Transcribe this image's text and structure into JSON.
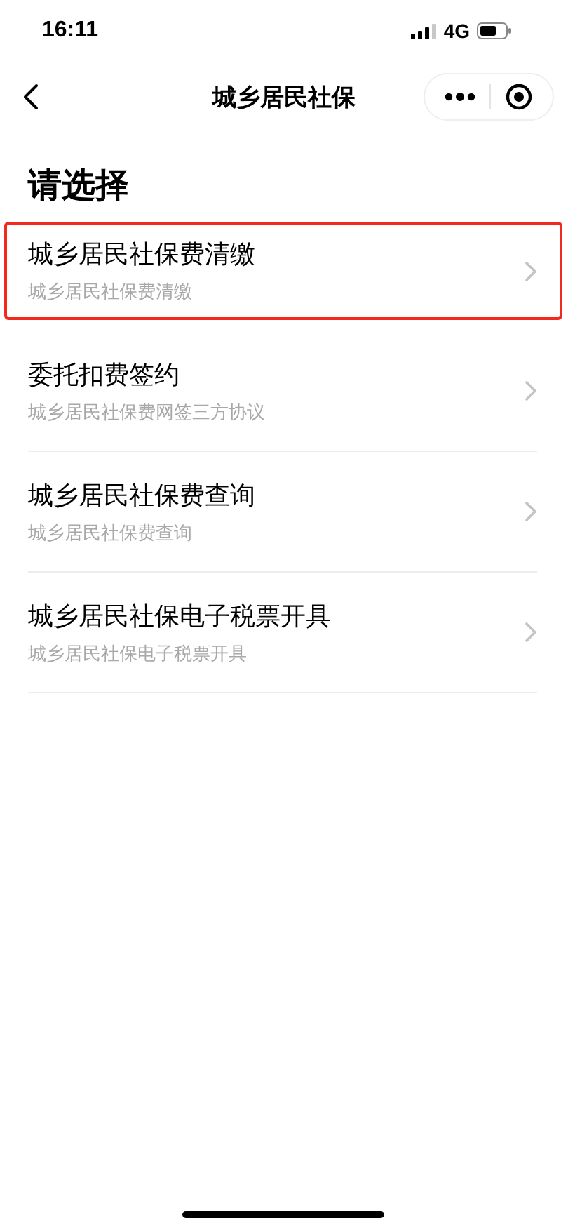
{
  "status_bar": {
    "time": "16:11",
    "network": "4G"
  },
  "nav_bar": {
    "title": "城乡居民社保"
  },
  "heading": "请选择",
  "items": [
    {
      "title": "城乡居民社保费清缴",
      "subtitle": "城乡居民社保费清缴",
      "selected": true
    },
    {
      "title": "委托扣费签约",
      "subtitle": "城乡居民社保费网签三方协议",
      "selected": false
    },
    {
      "title": "城乡居民社保费查询",
      "subtitle": "城乡居民社保费查询",
      "selected": false
    },
    {
      "title": "城乡居民社保电子税票开具",
      "subtitle": "城乡居民社保电子税票开具",
      "selected": false
    }
  ]
}
